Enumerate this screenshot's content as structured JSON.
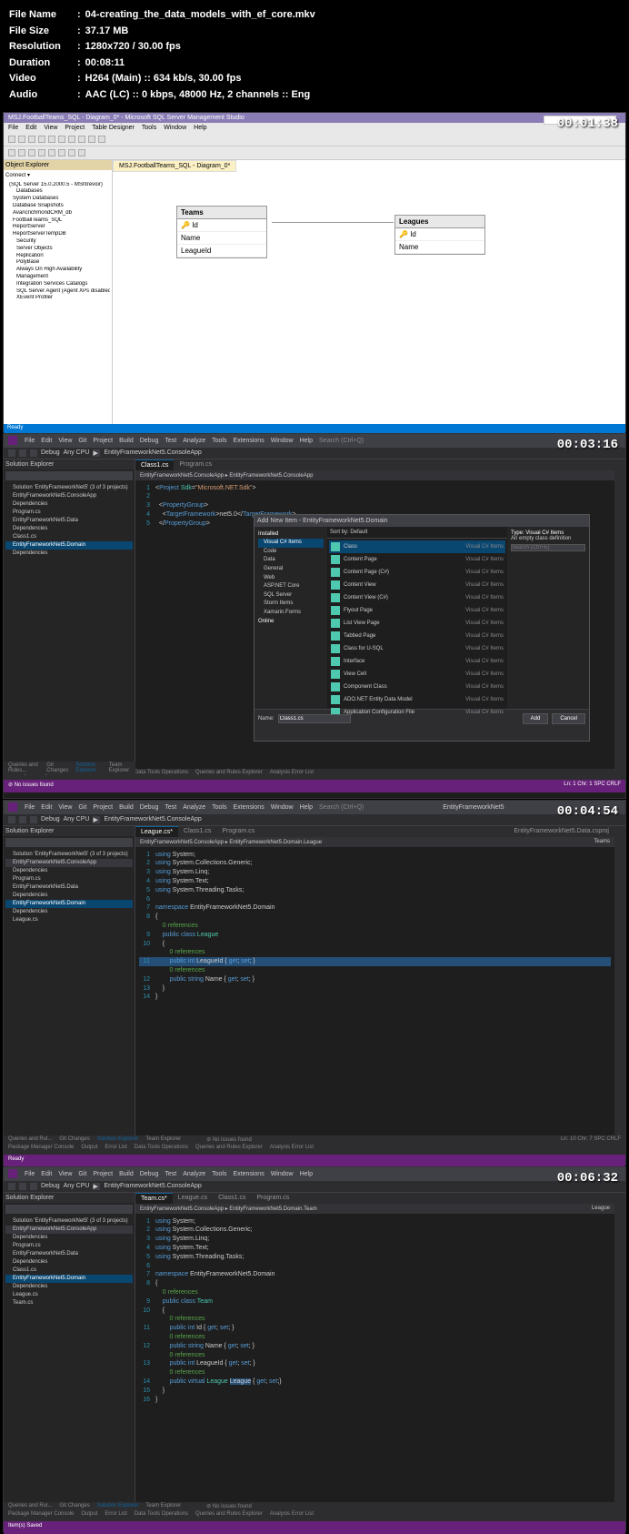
{
  "file_info": {
    "name_label": "File Name",
    "name": "04-creating_the_data_models_with_ef_core.mkv",
    "size_label": "File Size",
    "size": "37.17 MB",
    "res_label": "Resolution",
    "res": "1280x720 / 30.00 fps",
    "dur_label": "Duration",
    "dur": "00:08:11",
    "vid_label": "Video",
    "vid": "H264 (Main) :: 634 kb/s, 30.00 fps",
    "aud_label": "Audio",
    "aud": "AAC (LC) :: 0 kbps, 48000 Hz, 2 channels :: Eng"
  },
  "shot1": {
    "timestamp": "00:01:38",
    "title": "MSJ.FootballTeams_SQL - Diagram_0* - Microsoft SQL Server Management Studio",
    "menu": [
      "File",
      "Edit",
      "View",
      "Project",
      "Table Designer",
      "Tools",
      "Window",
      "Help"
    ],
    "search_placeholder": "Quick Launch (Ctrl+Q)",
    "obj_explorer": {
      "title": "Object Explorer",
      "connect": "Connect ▾",
      "tree": [
        "(SQL Server 15.0.2000.5 - MSI\\trevoir)",
        "Databases",
        "System Databases",
        "Database Snapshots",
        "AvancrichmondCRM_db",
        "FootballTeams_SQL",
        "ReportServer",
        "ReportServerTempDB",
        "Security",
        "Server Objects",
        "Replication",
        "PolyBase",
        "Always On High Availability",
        "Management",
        "Integration Services Catalogs",
        "SQL Server Agent (Agent XPs disabled)",
        "XEvent Profiler"
      ]
    },
    "tab": "MSJ.FootballTeams_SQL - Diagram_0*",
    "tables": {
      "teams": {
        "name": "Teams",
        "cols": [
          "Id",
          "Name",
          "LeagueId"
        ]
      },
      "leagues": {
        "name": "Leagues",
        "cols": [
          "Id",
          "Name"
        ]
      }
    },
    "status": "Ready"
  },
  "shot2": {
    "timestamp": "00:03:16",
    "menu": [
      "File",
      "Edit",
      "View",
      "Git",
      "Project",
      "Build",
      "Debug",
      "Test",
      "Analyze",
      "Tools",
      "Extensions",
      "Window",
      "Help"
    ],
    "search": "Search (Ctrl+Q)",
    "toolbar": {
      "config": "Debug",
      "platform": "Any CPU",
      "target": "EntityFrameworkNet5.ConsoleApp"
    },
    "sol_exp": {
      "title": "Solution Explorer",
      "search": "Search Solution Explorer (Ctrl+;)",
      "tree": [
        "Solution 'EntityFrameworkNet5' (3 of 3 projects)",
        "EntityFrameworkNet5.ConsoleApp",
        "Dependencies",
        "Program.cs",
        "EntityFrameworkNet5.Data",
        "Dependencies",
        "Class1.cs",
        "EntityFrameworkNet5.Domain",
        "Dependencies"
      ],
      "selected": "EntityFrameworkNet5.Domain"
    },
    "editor": {
      "tabs": [
        "Class1.cs",
        "Program.cs"
      ],
      "nav": "EntityFrameworkNet5.ConsoleApp ▸ EntityFrameworkNet5.ConsoleApp",
      "code": "<Project Sdk=\"Microsoft.NET.Sdk\">\n\n  <PropertyGroup>\n    <TargetFramework>net5.0</TargetFramework>\n  </PropertyGroup>"
    },
    "dialog": {
      "title": "Add New Item - EntityFrameworkNet5.Domain",
      "left_cat": "Installed",
      "left": [
        "Visual C# Items",
        "Code",
        "Data",
        "General",
        "Web",
        "ASP.NET Core",
        "SQL Server",
        "Storm Items",
        "Xamarin.Forms",
        "Online"
      ],
      "sort": "Sort by: Default",
      "search": "Search (Ctrl+E)",
      "items": [
        {
          "name": "Class",
          "type": "Visual C# Items"
        },
        {
          "name": "Content Page",
          "type": "Visual C# Items"
        },
        {
          "name": "Content Page (C#)",
          "type": "Visual C# Items"
        },
        {
          "name": "Content View",
          "type": "Visual C# Items"
        },
        {
          "name": "Content View (C#)",
          "type": "Visual C# Items"
        },
        {
          "name": "Flyout Page",
          "type": "Visual C# Items"
        },
        {
          "name": "List View Page",
          "type": "Visual C# Items"
        },
        {
          "name": "Tabbed Page",
          "type": "Visual C# Items"
        },
        {
          "name": "Class for U-SQL",
          "type": "Visual C# Items"
        },
        {
          "name": "Interface",
          "type": "Visual C# Items"
        },
        {
          "name": "View Cell",
          "type": "Visual C# Items"
        },
        {
          "name": "Component Class",
          "type": "Visual C# Items"
        },
        {
          "name": "ADO.NET Entity Data Model",
          "type": "Visual C# Items"
        },
        {
          "name": "Application Configuration File",
          "type": "Visual C# Items"
        }
      ],
      "right_title": "Type: Visual C# Items",
      "right_desc": "An empty class definition",
      "name_label": "Name:",
      "name_value": "Class1.cs",
      "btn_add": "Add",
      "btn_cancel": "Cancel"
    },
    "bottom_tabs": [
      "Queries and Rules...",
      "Git Changes",
      "Solution Explorer",
      "Team Explorer"
    ],
    "bottom2": [
      "Package Manager Console",
      "Output",
      "Error List",
      "Data Tools Operations",
      "Queries and Rules Explorer",
      "Analysis Error List"
    ],
    "status_left": "No issues found",
    "status_right": "Ln: 1  Chr: 1  SPC  CRLF"
  },
  "shot3": {
    "timestamp": "00:04:54",
    "menu": [
      "File",
      "Edit",
      "View",
      "Git",
      "Project",
      "Build",
      "Debug",
      "Test",
      "Analyze",
      "Tools",
      "Extensions",
      "Window",
      "Help"
    ],
    "search": "Search (Ctrl+Q)",
    "sol_name": "EntityFrameworkNet5",
    "toolbar": {
      "config": "Debug",
      "platform": "Any CPU",
      "target": "EntityFrameworkNet5.ConsoleApp"
    },
    "sol_exp": {
      "title": "Solution Explorer",
      "tree": [
        "Solution 'EntityFrameworkNet5' (3 of 3 projects)",
        "EntityFrameworkNet5.ConsoleApp",
        "Dependencies",
        "Program.cs",
        "EntityFrameworkNet5.Data",
        "Dependencies",
        "EntityFrameworkNet5.Domain",
        "Dependencies",
        "League.cs"
      ]
    },
    "editor": {
      "tabs": [
        "League.cs*",
        "Class1.cs",
        "Program.cs"
      ],
      "active": "League.cs*",
      "nav": "EntityFrameworkNet5.ConsoleApp ▸ EntityFrameworkNet5.Domain.League",
      "right_tab": "EntityFrameworkNet5.Data.csproj",
      "right_panel": "Teams"
    },
    "code_lines_text": {
      "l1": "using System;",
      "l2": "using System.Collections.Generic;",
      "l3": "using System.Linq;",
      "l4": "using System.Text;",
      "l5": "using System.Threading.Tasks;",
      "l7": "namespace EntityFrameworkNet5.Domain",
      "l8": "{",
      "l9a": "0 references",
      "l9": "    public class League",
      "l10": "    {",
      "l10a": "0 references",
      "l11": "        public int LeagueId { get; set; }",
      "l11a": "0 references",
      "l12": "        public string Name { get; set; }",
      "l13": "    }",
      "l14": "}"
    },
    "bottom_tabs": [
      "Queries and Rul...",
      "Git Changes",
      "Solution Explorer",
      "Team Explorer"
    ],
    "status_left": "No issues found",
    "status_right": "Ln: 10  Chr: 7  SPC  CRLF",
    "status": "Ready"
  },
  "shot4": {
    "timestamp": "00:06:32",
    "menu": [
      "File",
      "Edit",
      "View",
      "Git",
      "Project",
      "Build",
      "Debug",
      "Test",
      "Analyze",
      "Tools",
      "Extensions",
      "Window",
      "Help"
    ],
    "toolbar": {
      "config": "Debug",
      "platform": "Any CPU",
      "target": "EntityFrameworkNet5.ConsoleApp"
    },
    "sol_exp": {
      "tree": [
        "Solution 'EntityFrameworkNet5' (3 of 3 projects)",
        "EntityFrameworkNet5.ConsoleApp",
        "Dependencies",
        "Program.cs",
        "EntityFrameworkNet5.Data",
        "Dependencies",
        "Class1.cs",
        "EntityFrameworkNet5.Domain",
        "Dependencies",
        "League.cs",
        "Team.cs"
      ]
    },
    "editor": {
      "tabs": [
        "Team.cs*",
        "League.cs",
        "Class1.cs",
        "Program.cs"
      ],
      "active": "Team.cs*",
      "nav": "EntityFrameworkNet5.ConsoleApp ▸ EntityFrameworkNet5.Domain.Team",
      "right_panel": "League"
    },
    "code_lines_text": {
      "l1": "using System;",
      "l2": "using System.Collections.Generic;",
      "l3": "using System.Linq;",
      "l4": "using System.Text;",
      "l5": "using System.Threading.Tasks;",
      "l7": "namespace EntityFrameworkNet5.Domain",
      "l8": "{",
      "l8a": "0 references",
      "l9": "    public class Team",
      "l10": "    {",
      "l10a": "0 references",
      "l11": "        public int Id { get; set; }",
      "l11a": "0 references",
      "l12": "        public string Name { get; set; }",
      "l12a": "0 references",
      "l13": "        public int LeagueId { get; set; }",
      "l13a": "0 references",
      "l14": "        public virtual League League { get; set;}",
      "l15": "    }",
      "l16": "}"
    },
    "status": "Item(s) Saved",
    "status_left": "No issues found"
  }
}
